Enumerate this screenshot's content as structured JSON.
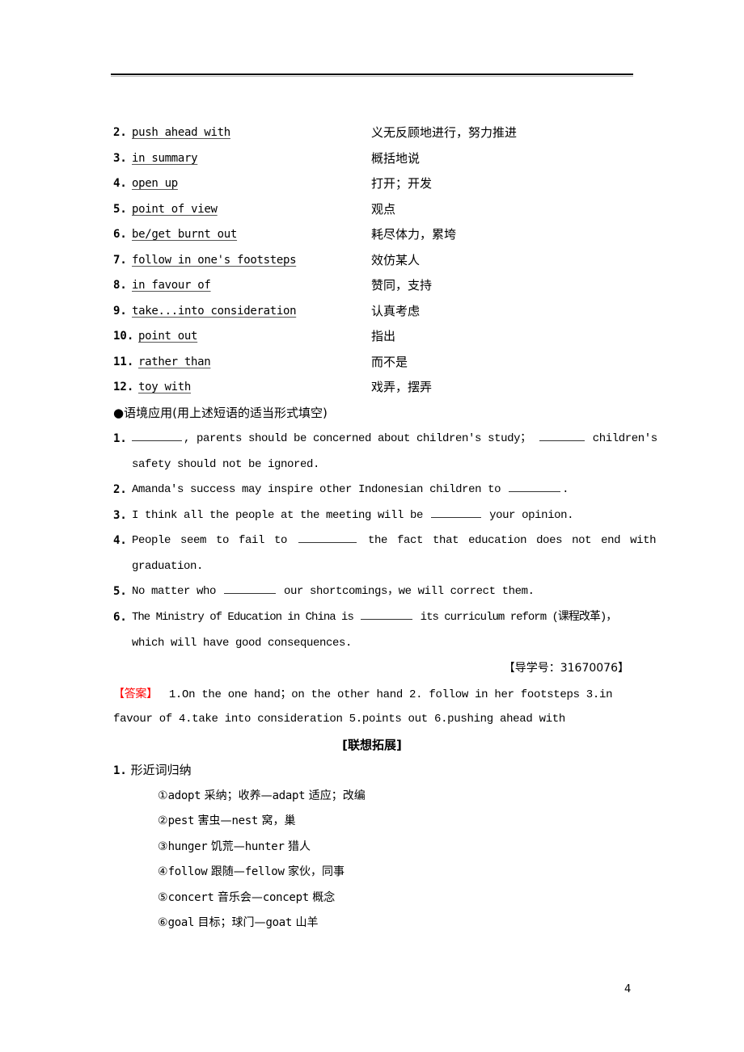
{
  "phrases": [
    {
      "num": "2.",
      "phrase": "push ahead with",
      "meaning": "义无反顾地进行，努力推进"
    },
    {
      "num": "3.",
      "phrase": "in summary",
      "meaning": "概括地说"
    },
    {
      "num": "4.",
      "phrase": "open up",
      "meaning": "打开；开发"
    },
    {
      "num": "5.",
      "phrase": "point of view",
      "meaning": "观点"
    },
    {
      "num": "6.",
      "phrase": "be/get burnt out",
      "meaning": "耗尽体力，累垮"
    },
    {
      "num": "7.",
      "phrase": "follow in one's footsteps",
      "meaning": "效仿某人"
    },
    {
      "num": "8.",
      "phrase": "in favour of",
      "meaning": "赞同，支持"
    },
    {
      "num": "9.",
      "phrase": "take...into consideration",
      "meaning": "认真考虑"
    },
    {
      "num": "10.",
      "phrase": "point out",
      "meaning": "指出"
    },
    {
      "num": "11.",
      "phrase": "rather than",
      "meaning": "而不是"
    },
    {
      "num": "12.",
      "phrase": "toy with",
      "meaning": "戏弄，摆弄"
    }
  ],
  "context_section": {
    "heading": "●语境应用(用上述短语的适当形式填空)"
  },
  "exercises": [
    {
      "num": "1.",
      "part1": ", parents should be concerned about children's study；",
      "part2": " children's",
      "cont": "safety should not be ignored."
    },
    {
      "num": "2.",
      "part1": "Amanda's success may inspire other Indonesian children to ",
      "part2": "."
    },
    {
      "num": "3.",
      "part1": "I think all the people at the meeting will be ",
      "part2": " your opinion."
    },
    {
      "num": "4.",
      "part1": "People seem to fail to ",
      "part2": " the fact that education does not end with",
      "cont": "graduation."
    },
    {
      "num": "5.",
      "part1": "No matter who ",
      "part2": " our shortcomings，we will correct them."
    },
    {
      "num": "6.",
      "part1": "The Ministry of Education in China is ",
      "part2": " its curriculum reform (课程改革)，",
      "cont": "which will have good consequences."
    }
  ],
  "guide_ref": "【导学号：31670076】",
  "answer": {
    "label": "【答案】",
    "line1": "1.On the one hand；on the other hand  2. follow in her footsteps  3.in",
    "line2": "favour of  4.take into consideration  5.points out  6.pushing ahead with"
  },
  "extension": {
    "heading": "[联想拓展]",
    "sub_num": "1.",
    "sub_title": "形近词归纳",
    "pairs": [
      {
        "marker": "①",
        "w1": "adopt",
        "m1": " 采纳；收养—",
        "w2": "adapt",
        "m2": " 适应；改编"
      },
      {
        "marker": "②",
        "w1": "pest",
        "m1": " 害虫—",
        "w2": "nest",
        "m2": " 窝，巢"
      },
      {
        "marker": "③",
        "w1": "hunger",
        "m1": " 饥荒—",
        "w2": "hunter",
        "m2": " 猎人"
      },
      {
        "marker": "④",
        "w1": "follow",
        "m1": " 跟随—",
        "w2": "fellow",
        "m2": " 家伙，同事"
      },
      {
        "marker": "⑤",
        "w1": "concert",
        "m1": " 音乐会—",
        "w2": "concept",
        "m2": " 概念"
      },
      {
        "marker": "⑥",
        "w1": "goal",
        "m1": " 目标；球门—",
        "w2": "goat",
        "m2": " 山羊"
      }
    ]
  },
  "page_number": "4"
}
